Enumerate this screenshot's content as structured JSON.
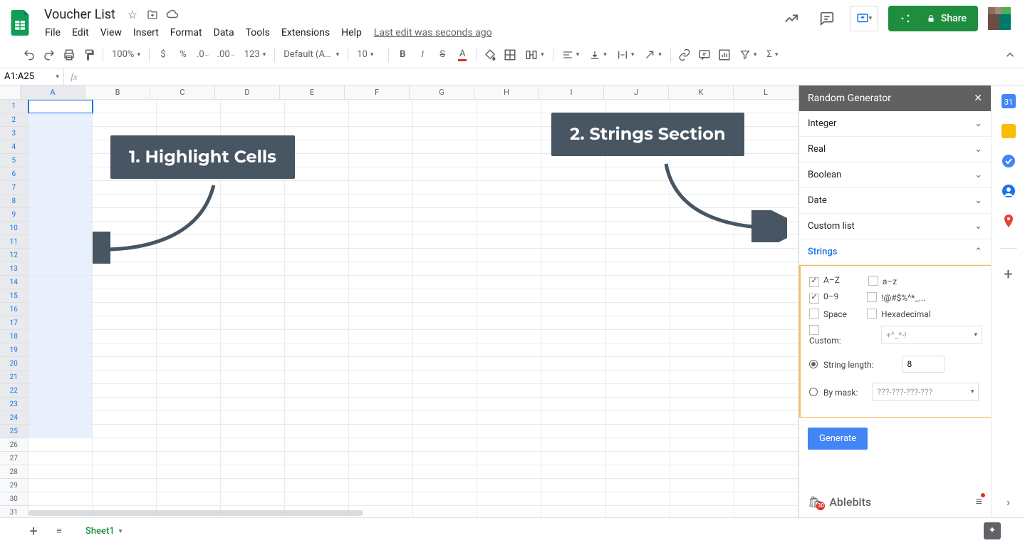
{
  "doc": {
    "name": "Voucher List",
    "last_edit": "Last edit was seconds ago"
  },
  "menus": [
    "File",
    "Edit",
    "View",
    "Insert",
    "Format",
    "Data",
    "Tools",
    "Extensions",
    "Help"
  ],
  "share_label": "Share",
  "toolbar": {
    "zoom": "100%",
    "font": "Default (Ari...",
    "font_size": "10"
  },
  "name_box": "A1:A25",
  "columns": [
    "A",
    "B",
    "C",
    "D",
    "E",
    "F",
    "G",
    "H",
    "I",
    "J",
    "K",
    "L"
  ],
  "row_count": 31,
  "selection": {
    "active_row": 1,
    "sel_rows_end": 25
  },
  "annotations": {
    "a1": "1. Highlight Cells",
    "a2": "2. Strings Section"
  },
  "sidebar": {
    "title": "Random Generator",
    "sections": [
      "Integer",
      "Real",
      "Boolean",
      "Date",
      "Custom list"
    ],
    "strings_label": "Strings",
    "opts": {
      "AZ": "A–Z",
      "az": "a–z",
      "d09": "0–9",
      "sym": "!@#$%^*_...",
      "space": "Space",
      "hex": "Hexadecimal",
      "custom": "Custom:",
      "custom_ph": "+^_*-!",
      "len_label": "String length:",
      "len_val": "8",
      "mask_label": "By mask:",
      "mask_ph": "???-???-???-???"
    },
    "generate": "Generate",
    "footer_brand": "Ablebits"
  },
  "sheet_tab": "Sheet1"
}
